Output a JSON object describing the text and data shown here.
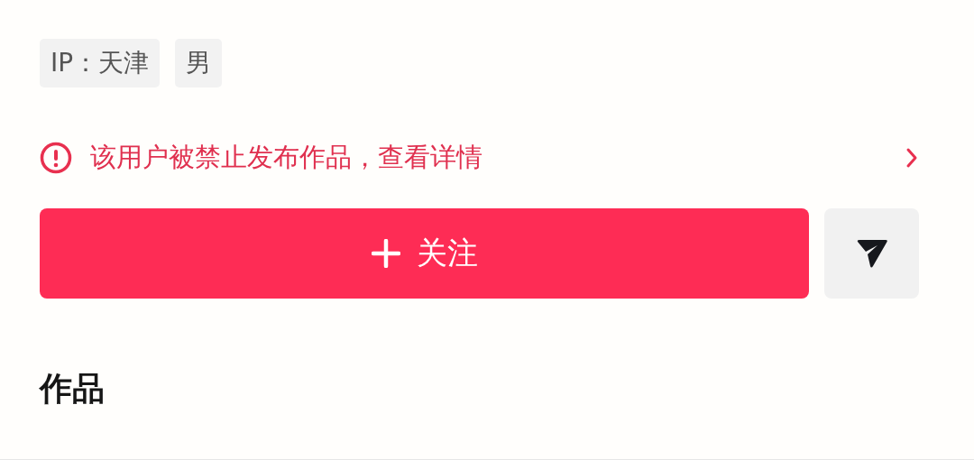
{
  "tags": [
    {
      "label": "IP：天津"
    },
    {
      "label": "男"
    }
  ],
  "notice": {
    "text": "该用户被禁止发布作品，查看详情"
  },
  "follow_button": {
    "label": "关注"
  },
  "section_title": "作品"
}
